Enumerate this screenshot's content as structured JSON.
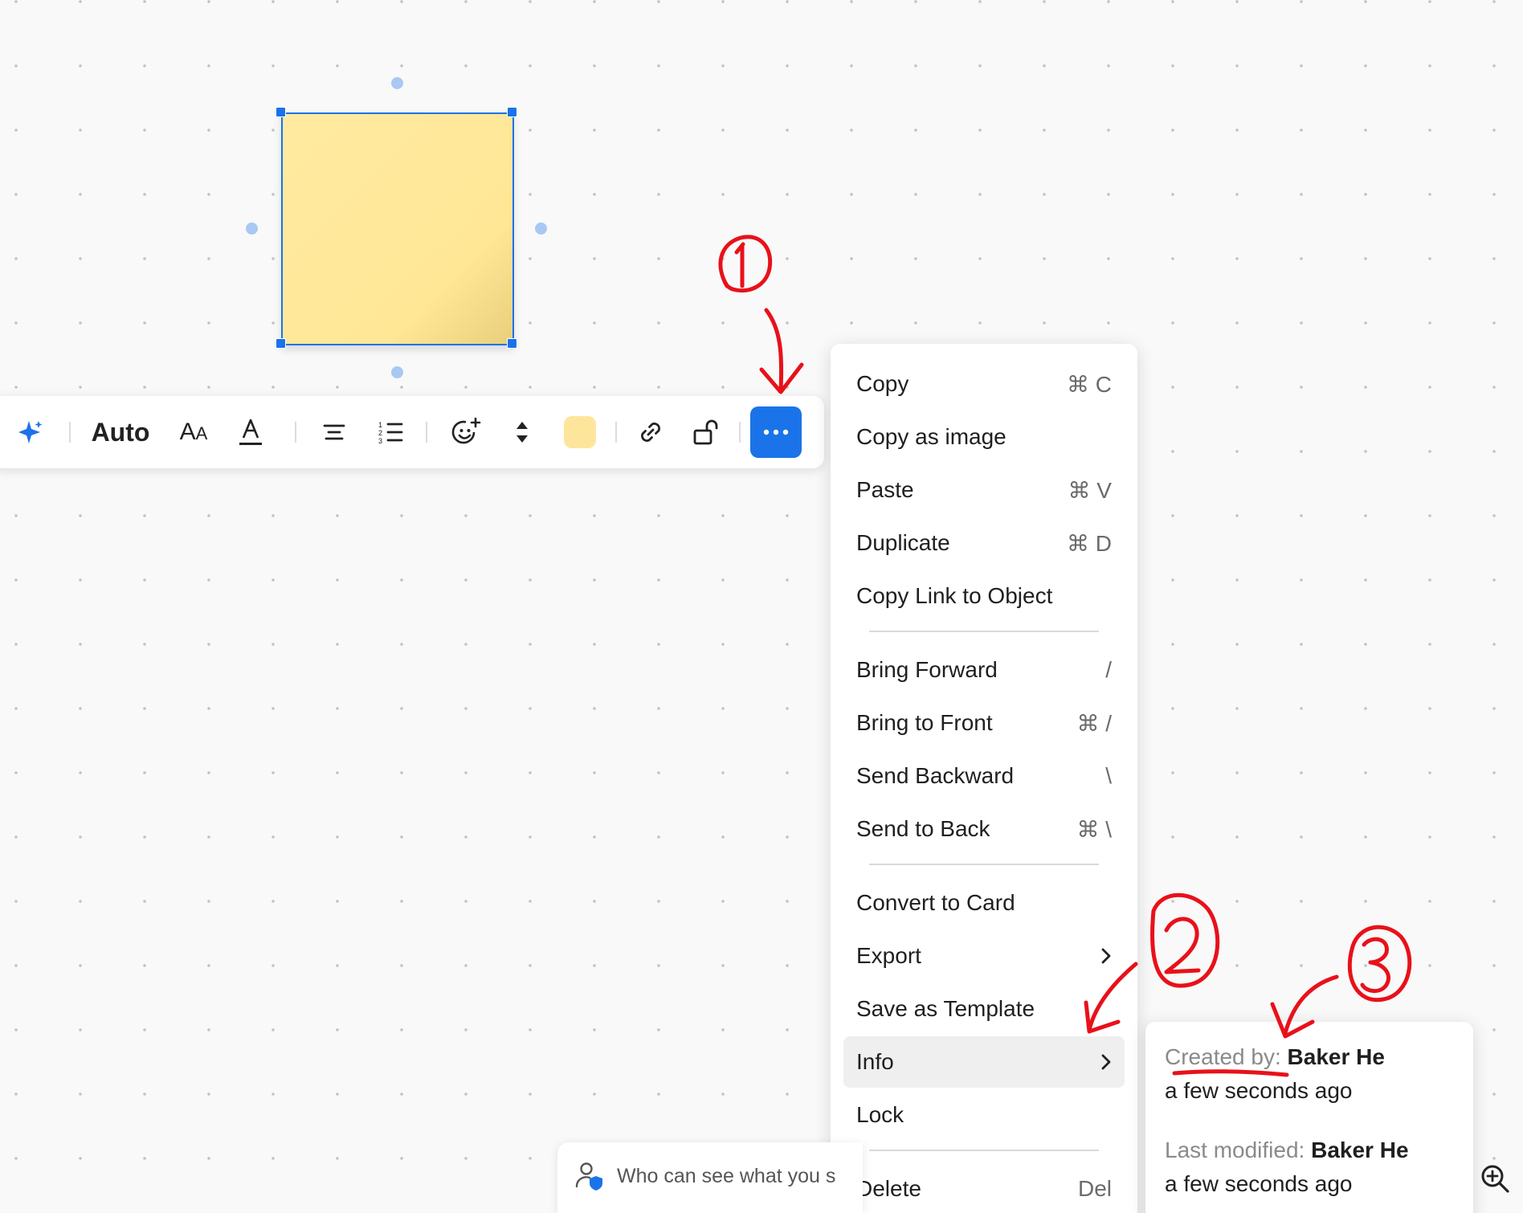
{
  "toolbar": {
    "font_size_label": "Auto",
    "note_color": "#fde69c",
    "accent_color": "#1a73e8",
    "icons": [
      "ai-sparkle-icon",
      "text-size-icon",
      "text-color-icon",
      "align-center-icon",
      "numbered-list-icon",
      "add-emoji-icon",
      "reorder-arrows-icon",
      "link-icon",
      "unlock-icon",
      "more-options-icon"
    ]
  },
  "menu": {
    "copy": {
      "label": "Copy",
      "shortcut": "⌘ C"
    },
    "copy_image": {
      "label": "Copy as image"
    },
    "paste": {
      "label": "Paste",
      "shortcut": "⌘ V"
    },
    "duplicate": {
      "label": "Duplicate",
      "shortcut": "⌘ D"
    },
    "copy_link": {
      "label": "Copy Link to Object"
    },
    "bring_forward": {
      "label": "Bring Forward",
      "shortcut": "/"
    },
    "bring_front": {
      "label": "Bring to Front",
      "shortcut": "⌘ /"
    },
    "send_backward": {
      "label": "Send Backward",
      "shortcut": "\\"
    },
    "send_back": {
      "label": "Send to Back",
      "shortcut": "⌘ \\"
    },
    "convert_card": {
      "label": "Convert to Card"
    },
    "export": {
      "label": "Export"
    },
    "save_template": {
      "label": "Save as Template"
    },
    "info": {
      "label": "Info"
    },
    "lock": {
      "label": "Lock"
    },
    "delete": {
      "label": "Delete",
      "shortcut": "Del"
    }
  },
  "info_panel": {
    "created_label": "Created by:",
    "created_by": "Baker He",
    "created_time": "a few seconds ago",
    "modified_label": "Last modified:",
    "modified_by": "Baker He",
    "modified_time": "a few seconds ago"
  },
  "footer": {
    "visibility_text": "Who can see what you s"
  },
  "annotation_color": "#e8111a"
}
